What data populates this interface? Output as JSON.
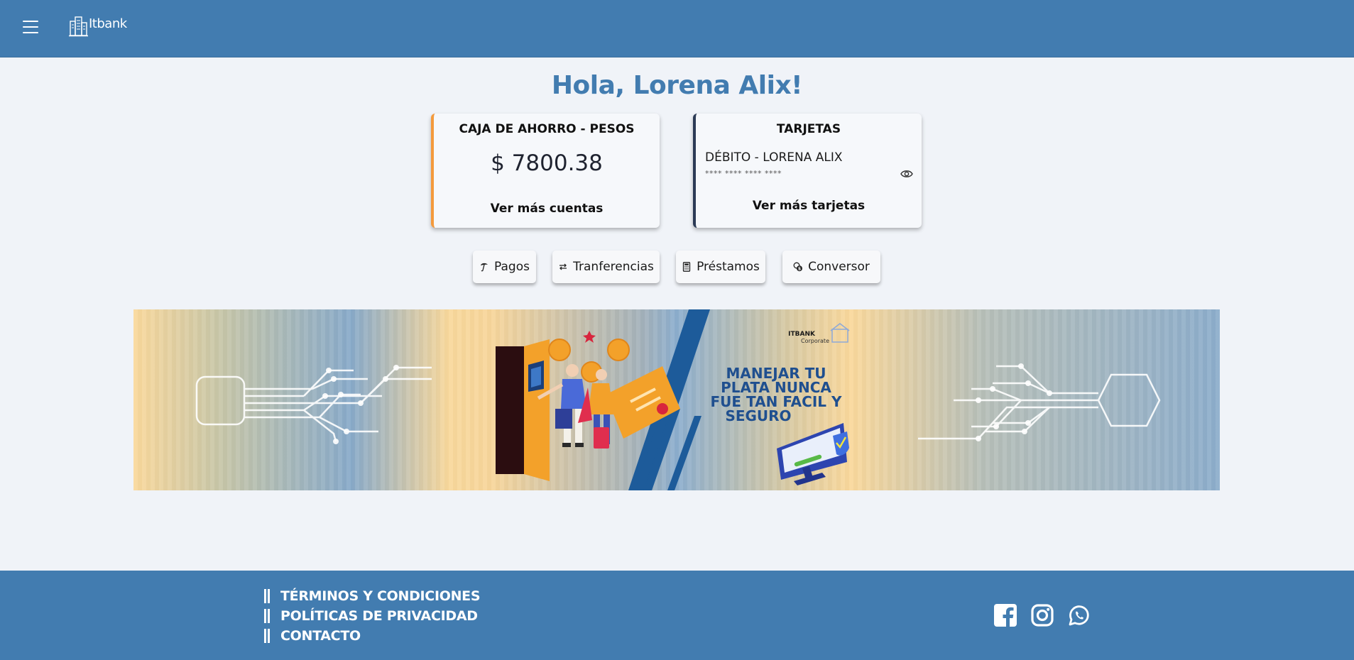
{
  "header": {
    "logo_text": "Itbank",
    "menu_icon": "hamburger-menu-icon"
  },
  "greeting": "Hola, Lorena Alix!",
  "accounts_card": {
    "title": "CAJA DE AHORRO - PESOS",
    "balance": "$ 7800.38",
    "link": "Ver más cuentas",
    "accent_color": "#f49a3c"
  },
  "cards_card": {
    "title": "TARJETAS",
    "card_name": "DÉBITO - LORENA ALIX",
    "card_number": "**** **** **** ****",
    "link": "Ver más tarjetas",
    "eye_icon": "eye-icon",
    "accent_color": "#2b3a55"
  },
  "quick_actions": [
    {
      "label": "Pagos",
      "icon": "umbrella-icon"
    },
    {
      "label": "Tranferencias",
      "icon": "arrows-exchange-icon"
    },
    {
      "label": "Préstamos",
      "icon": "calculator-icon"
    },
    {
      "label": "Conversor",
      "icon": "coins-icon"
    }
  ],
  "banner": {
    "brand": "ITBANK",
    "brand_sub": "Corporate",
    "headline": [
      "MANEJAR TU",
      "PLATA NUNCA",
      "FUE TAN FACIL Y",
      "SEGURO"
    ]
  },
  "footer": {
    "links": [
      "TÉRMINOS Y CONDICIONES",
      "POLÍTICAS DE PRIVACIDAD",
      "CONTACTO"
    ],
    "social": [
      "facebook-icon",
      "instagram-icon",
      "whatsapp-icon"
    ]
  },
  "colors": {
    "primary": "#427cb0",
    "background": "#f0f3f8"
  }
}
